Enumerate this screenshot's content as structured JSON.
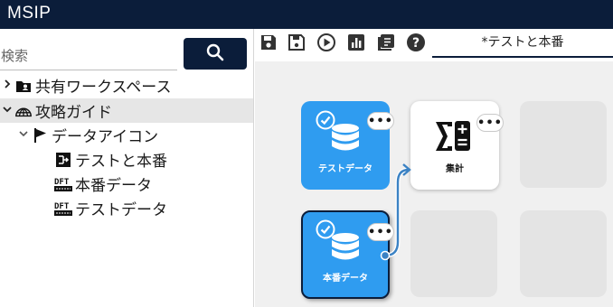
{
  "header": {
    "title": "MSIP"
  },
  "search": {
    "placeholder": "検索"
  },
  "tree": {
    "items": [
      {
        "label": "共有ワークスペース",
        "chevron": "›",
        "icon": "folder-person-icon"
      },
      {
        "label": "攻略ガイド",
        "chevron": "⌄",
        "icon": "globe-icon"
      },
      {
        "label": "データアイコン",
        "chevron": "⌄",
        "icon": "flag-icon"
      },
      {
        "label": "テストと本番",
        "icon": "flow-icon"
      },
      {
        "label": "本番データ",
        "icon": "dft-icon"
      },
      {
        "label": "テストデータ",
        "icon": "dft-icon"
      }
    ],
    "dft_glyph": "DFT"
  },
  "toolbar": {
    "icons": [
      "save-icon",
      "save-as-icon",
      "run-icon",
      "chart-icon",
      "export-icon",
      "help-icon"
    ],
    "help_glyph": "?",
    "tab_label": "*テストと本番"
  },
  "canvas": {
    "nodes": {
      "test_data": {
        "label": "テストデータ"
      },
      "prod_data": {
        "label": "本番データ"
      },
      "calc": {
        "label": "集計"
      }
    },
    "more_glyph": "•••"
  },
  "colors": {
    "navy": "#0b1d3a",
    "node_blue": "#2f9cf0",
    "connector": "#3b82c4"
  }
}
